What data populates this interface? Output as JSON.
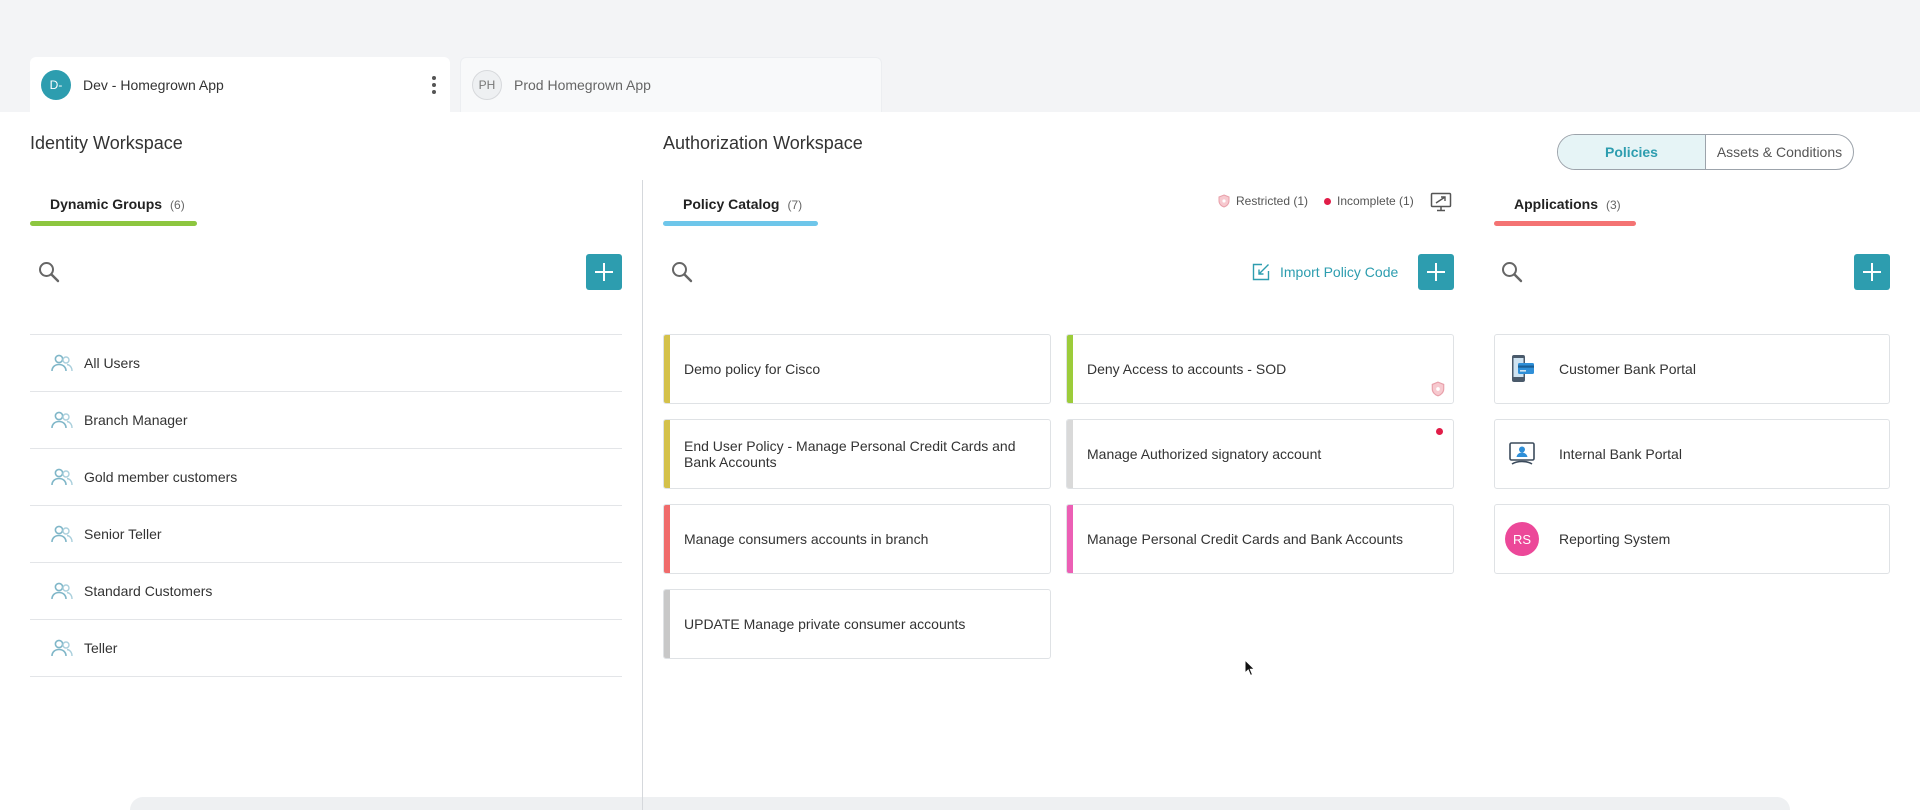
{
  "app_tabs": [
    {
      "initials": "D-",
      "name": "Dev - Homegrown App",
      "active": true
    },
    {
      "initials": "PH",
      "name": "Prod Homegrown App",
      "active": false
    }
  ],
  "identity": {
    "title": "Identity Workspace",
    "section_label": "Dynamic Groups",
    "section_count": "(6)",
    "underline_color": "#8dc63f",
    "groups": [
      "All Users",
      "Branch Manager",
      "Gold member customers",
      "Senior Teller",
      "Standard Customers",
      "Teller"
    ]
  },
  "authorization": {
    "title": "Authorization Workspace",
    "section_label": "Policy Catalog",
    "section_count": "(7)",
    "underline_color": "#6ec6ea",
    "legend_restricted": "Restricted (1)",
    "legend_incomplete": "Incomplete (1)",
    "import_label": "Import Policy Code",
    "policies": [
      {
        "name": "Demo policy for Cisco",
        "color": "#d4c14a"
      },
      {
        "name": "Deny Access to accounts - SOD",
        "color": "#9ccc3a",
        "restricted": true
      },
      {
        "name": "End User Policy - Manage Personal Credit Cards and Bank Accounts",
        "color": "#d4c14a"
      },
      {
        "name": "Manage Authorized signatory account",
        "color": "#d9d9d9",
        "incomplete": true
      },
      {
        "name": "Manage consumers accounts in branch",
        "color": "#f06b6b"
      },
      {
        "name": "Manage Personal Credit Cards and Bank Accounts",
        "color": "#ec5fb5"
      },
      {
        "name": "UPDATE Manage private consumer accounts",
        "color": "#c8c8c8"
      }
    ]
  },
  "toggle": {
    "policies": "Policies",
    "assets": "Assets & Conditions"
  },
  "applications": {
    "section_label": "Applications",
    "section_count": "(3)",
    "underline_color": "#f47373",
    "items": [
      {
        "name": "Customer Bank Portal",
        "icon": "mobile-bank-icon"
      },
      {
        "name": "Internal Bank Portal",
        "icon": "monitor-user-icon"
      },
      {
        "name": "Reporting System",
        "icon": "avatar",
        "initials": "RS"
      }
    ]
  },
  "colors": {
    "accent": "#2d9daf",
    "incomplete": "#e11d48",
    "reporting_avatar": "#ec4899"
  }
}
